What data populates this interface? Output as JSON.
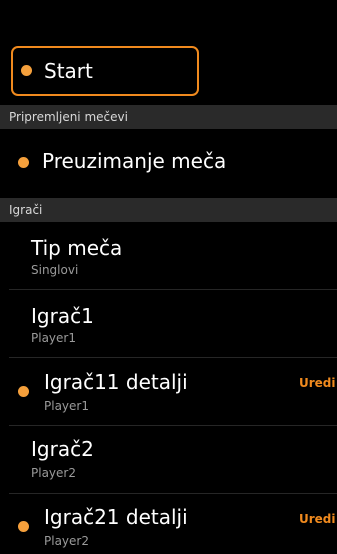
{
  "start": {
    "label": "Start"
  },
  "sections": {
    "prepared": "Pripremljeni mečevi",
    "players": "Igrači"
  },
  "prepared_item": {
    "label": "Preuzimanje meča"
  },
  "rows": [
    {
      "title": "Tip meča",
      "subtitle": "Singlovi"
    },
    {
      "title": "Igrač1",
      "subtitle": "Player1"
    },
    {
      "title": "Igrač11 detalji",
      "subtitle": "Player1",
      "action": "Uredi"
    },
    {
      "title": "Igrač2",
      "subtitle": "Player2"
    },
    {
      "title": "Igrač21 detalji",
      "subtitle": "Player2",
      "action": "Uredi"
    }
  ],
  "colors": {
    "accent": "#f08a1e",
    "dot": "#f5a03c",
    "section_bg": "#2a2a2a"
  }
}
